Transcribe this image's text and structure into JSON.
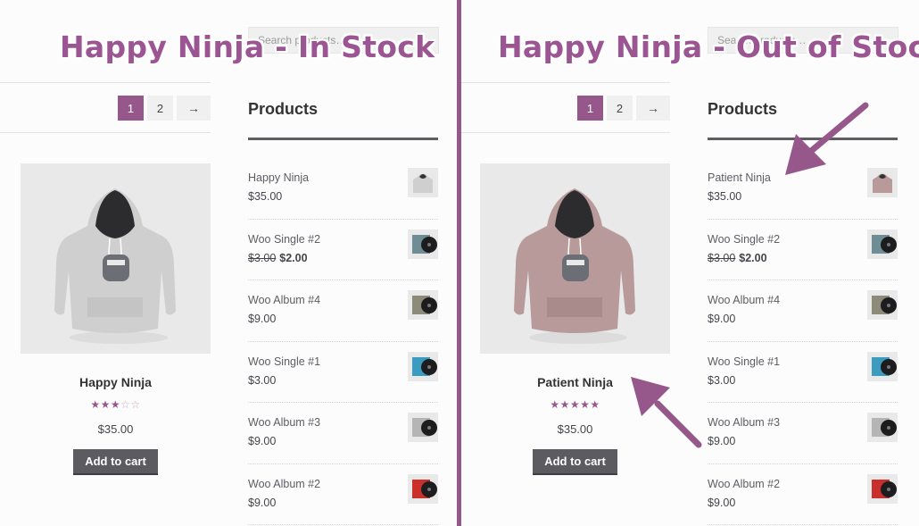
{
  "panels": [
    {
      "heading": "Happy Ninja - In Stock",
      "search_placeholder": "Search products…",
      "pagination": [
        "1",
        "2",
        "→"
      ],
      "featured": {
        "title": "Happy Ninja",
        "rating_stars": 3,
        "rating_max": 5,
        "price": "$35.00",
        "button": "Add to cart",
        "hoodie_color": "#cfcfcf"
      },
      "widget_title": "Products",
      "products": [
        {
          "name": "Happy Ninja",
          "price": "$35.00",
          "thumb": "hoodie-gray"
        },
        {
          "name": "Woo Single #2",
          "old_price": "$3.00",
          "price": "$2.00",
          "thumb": "vinyl-teal"
        },
        {
          "name": "Woo Album #4",
          "price": "$9.00",
          "thumb": "vinyl-olive"
        },
        {
          "name": "Woo Single #1",
          "price": "$3.00",
          "thumb": "vinyl-blue"
        },
        {
          "name": "Woo Album #3",
          "price": "$9.00",
          "thumb": "vinyl-gray"
        },
        {
          "name": "Woo Album #2",
          "price": "$9.00",
          "thumb": "vinyl-red"
        }
      ]
    },
    {
      "heading": "Happy Ninja - Out of Stock",
      "search_placeholder": "Search products…",
      "pagination": [
        "1",
        "2",
        "→"
      ],
      "featured": {
        "title": "Patient Ninja",
        "rating_stars": 5,
        "rating_max": 5,
        "price": "$35.00",
        "button": "Add to cart",
        "hoodie_color": "#b89a9a"
      },
      "widget_title": "Products",
      "products": [
        {
          "name": "Patient Ninja",
          "price": "$35.00",
          "thumb": "hoodie-pink"
        },
        {
          "name": "Woo Single #2",
          "old_price": "$3.00",
          "price": "$2.00",
          "thumb": "vinyl-teal"
        },
        {
          "name": "Woo Album #4",
          "price": "$9.00",
          "thumb": "vinyl-olive"
        },
        {
          "name": "Woo Single #1",
          "price": "$3.00",
          "thumb": "vinyl-blue"
        },
        {
          "name": "Woo Album #3",
          "price": "$9.00",
          "thumb": "vinyl-gray"
        },
        {
          "name": "Woo Album #2",
          "price": "$9.00",
          "thumb": "vinyl-red"
        }
      ]
    }
  ],
  "colors": {
    "accent": "#96588a",
    "button": "#5b5b60",
    "divider": "#96588a"
  }
}
